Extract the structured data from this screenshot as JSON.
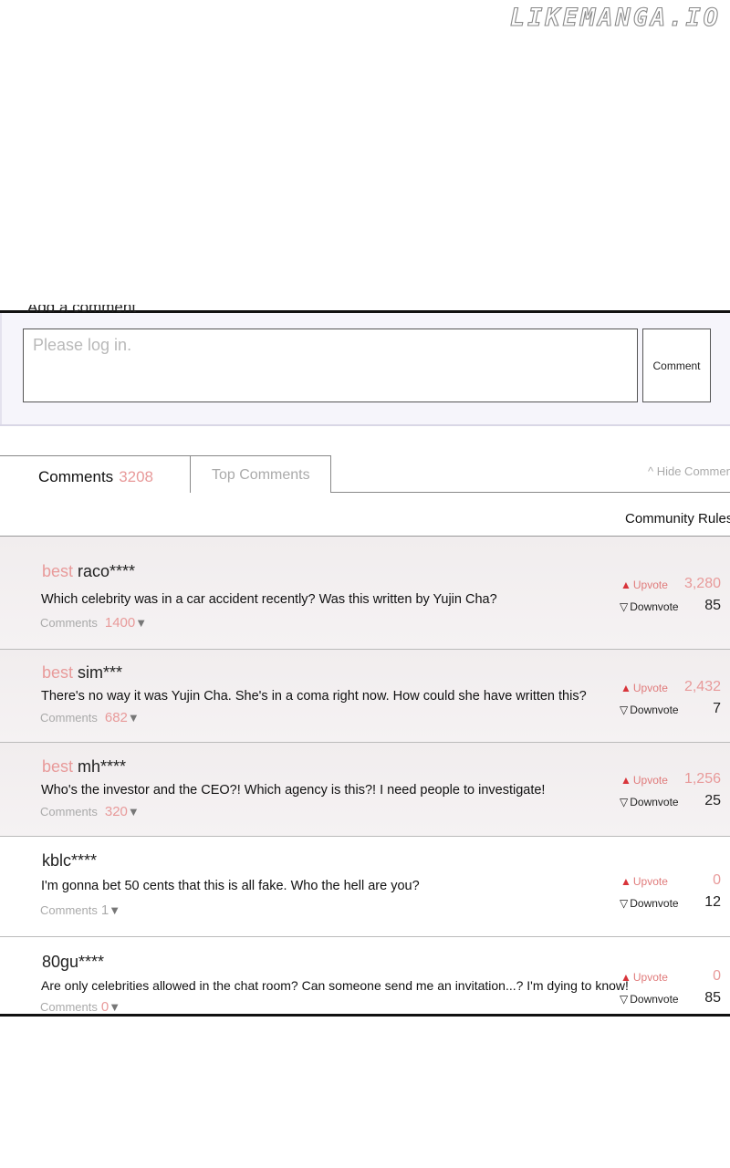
{
  "watermark": "LIKEMANGA.IO",
  "comment_form": {
    "title": "Add a comment",
    "placeholder": "Please log in.",
    "button_label": "Comment"
  },
  "tabs": {
    "comments_label": "Comments",
    "comments_count": "3208",
    "top_comments_label": "Top Comments",
    "hide_label": "^ Hide Comments",
    "rules_label": "Community Rules"
  },
  "labels": {
    "best": "best",
    "comments": "Comments",
    "upvote": "Upvote",
    "downvote": "Downvote"
  },
  "comments": [
    {
      "best": true,
      "user": "raco****",
      "text": "Which celebrity was in a car accident recently? Was this written by Yujin Cha?",
      "replies": "1400",
      "up": "3,280",
      "down": "85"
    },
    {
      "best": true,
      "user": "sim***",
      "text": "There's no way it was Yujin Cha. She's in a coma right now. How could she have written this?",
      "replies": "682",
      "up": "2,432",
      "down": "7"
    },
    {
      "best": true,
      "user": "mh****",
      "text": "Who's the investor and the CEO?! Which agency is this?! I need people to investigate!",
      "replies": "320",
      "up": "1,256",
      "down": "25"
    },
    {
      "best": false,
      "user": "kblc****",
      "text": "I'm gonna bet 50 cents that this is all fake. Who the hell are you?",
      "replies": "1",
      "up": "0",
      "down": "12"
    },
    {
      "best": false,
      "user": "80gu****",
      "text": "Are only celebrities allowed in the chat room? Can someone send me an invitation...? I'm dying to know!",
      "replies": "0",
      "up": "0",
      "down": "85"
    }
  ]
}
